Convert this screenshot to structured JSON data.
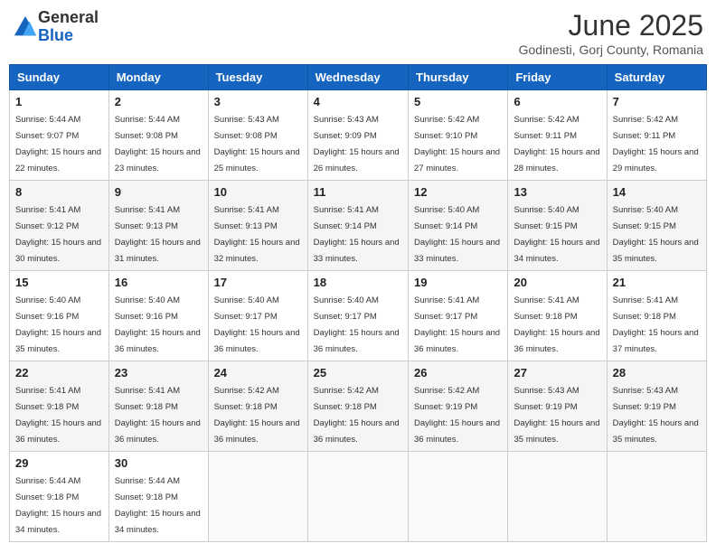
{
  "header": {
    "logo_general": "General",
    "logo_blue": "Blue",
    "month": "June 2025",
    "location": "Godinesti, Gorj County, Romania"
  },
  "weekdays": [
    "Sunday",
    "Monday",
    "Tuesday",
    "Wednesday",
    "Thursday",
    "Friday",
    "Saturday"
  ],
  "weeks": [
    [
      {
        "day": "1",
        "sunrise": "5:44 AM",
        "sunset": "9:07 PM",
        "daylight": "15 hours and 22 minutes."
      },
      {
        "day": "2",
        "sunrise": "5:44 AM",
        "sunset": "9:08 PM",
        "daylight": "15 hours and 23 minutes."
      },
      {
        "day": "3",
        "sunrise": "5:43 AM",
        "sunset": "9:08 PM",
        "daylight": "15 hours and 25 minutes."
      },
      {
        "day": "4",
        "sunrise": "5:43 AM",
        "sunset": "9:09 PM",
        "daylight": "15 hours and 26 minutes."
      },
      {
        "day": "5",
        "sunrise": "5:42 AM",
        "sunset": "9:10 PM",
        "daylight": "15 hours and 27 minutes."
      },
      {
        "day": "6",
        "sunrise": "5:42 AM",
        "sunset": "9:11 PM",
        "daylight": "15 hours and 28 minutes."
      },
      {
        "day": "7",
        "sunrise": "5:42 AM",
        "sunset": "9:11 PM",
        "daylight": "15 hours and 29 minutes."
      }
    ],
    [
      {
        "day": "8",
        "sunrise": "5:41 AM",
        "sunset": "9:12 PM",
        "daylight": "15 hours and 30 minutes."
      },
      {
        "day": "9",
        "sunrise": "5:41 AM",
        "sunset": "9:13 PM",
        "daylight": "15 hours and 31 minutes."
      },
      {
        "day": "10",
        "sunrise": "5:41 AM",
        "sunset": "9:13 PM",
        "daylight": "15 hours and 32 minutes."
      },
      {
        "day": "11",
        "sunrise": "5:41 AM",
        "sunset": "9:14 PM",
        "daylight": "15 hours and 33 minutes."
      },
      {
        "day": "12",
        "sunrise": "5:40 AM",
        "sunset": "9:14 PM",
        "daylight": "15 hours and 33 minutes."
      },
      {
        "day": "13",
        "sunrise": "5:40 AM",
        "sunset": "9:15 PM",
        "daylight": "15 hours and 34 minutes."
      },
      {
        "day": "14",
        "sunrise": "5:40 AM",
        "sunset": "9:15 PM",
        "daylight": "15 hours and 35 minutes."
      }
    ],
    [
      {
        "day": "15",
        "sunrise": "5:40 AM",
        "sunset": "9:16 PM",
        "daylight": "15 hours and 35 minutes."
      },
      {
        "day": "16",
        "sunrise": "5:40 AM",
        "sunset": "9:16 PM",
        "daylight": "15 hours and 36 minutes."
      },
      {
        "day": "17",
        "sunrise": "5:40 AM",
        "sunset": "9:17 PM",
        "daylight": "15 hours and 36 minutes."
      },
      {
        "day": "18",
        "sunrise": "5:40 AM",
        "sunset": "9:17 PM",
        "daylight": "15 hours and 36 minutes."
      },
      {
        "day": "19",
        "sunrise": "5:41 AM",
        "sunset": "9:17 PM",
        "daylight": "15 hours and 36 minutes."
      },
      {
        "day": "20",
        "sunrise": "5:41 AM",
        "sunset": "9:18 PM",
        "daylight": "15 hours and 36 minutes."
      },
      {
        "day": "21",
        "sunrise": "5:41 AM",
        "sunset": "9:18 PM",
        "daylight": "15 hours and 37 minutes."
      }
    ],
    [
      {
        "day": "22",
        "sunrise": "5:41 AM",
        "sunset": "9:18 PM",
        "daylight": "15 hours and 36 minutes."
      },
      {
        "day": "23",
        "sunrise": "5:41 AM",
        "sunset": "9:18 PM",
        "daylight": "15 hours and 36 minutes."
      },
      {
        "day": "24",
        "sunrise": "5:42 AM",
        "sunset": "9:18 PM",
        "daylight": "15 hours and 36 minutes."
      },
      {
        "day": "25",
        "sunrise": "5:42 AM",
        "sunset": "9:18 PM",
        "daylight": "15 hours and 36 minutes."
      },
      {
        "day": "26",
        "sunrise": "5:42 AM",
        "sunset": "9:19 PM",
        "daylight": "15 hours and 36 minutes."
      },
      {
        "day": "27",
        "sunrise": "5:43 AM",
        "sunset": "9:19 PM",
        "daylight": "15 hours and 35 minutes."
      },
      {
        "day": "28",
        "sunrise": "5:43 AM",
        "sunset": "9:19 PM",
        "daylight": "15 hours and 35 minutes."
      }
    ],
    [
      {
        "day": "29",
        "sunrise": "5:44 AM",
        "sunset": "9:18 PM",
        "daylight": "15 hours and 34 minutes."
      },
      {
        "day": "30",
        "sunrise": "5:44 AM",
        "sunset": "9:18 PM",
        "daylight": "15 hours and 34 minutes."
      },
      null,
      null,
      null,
      null,
      null
    ]
  ]
}
